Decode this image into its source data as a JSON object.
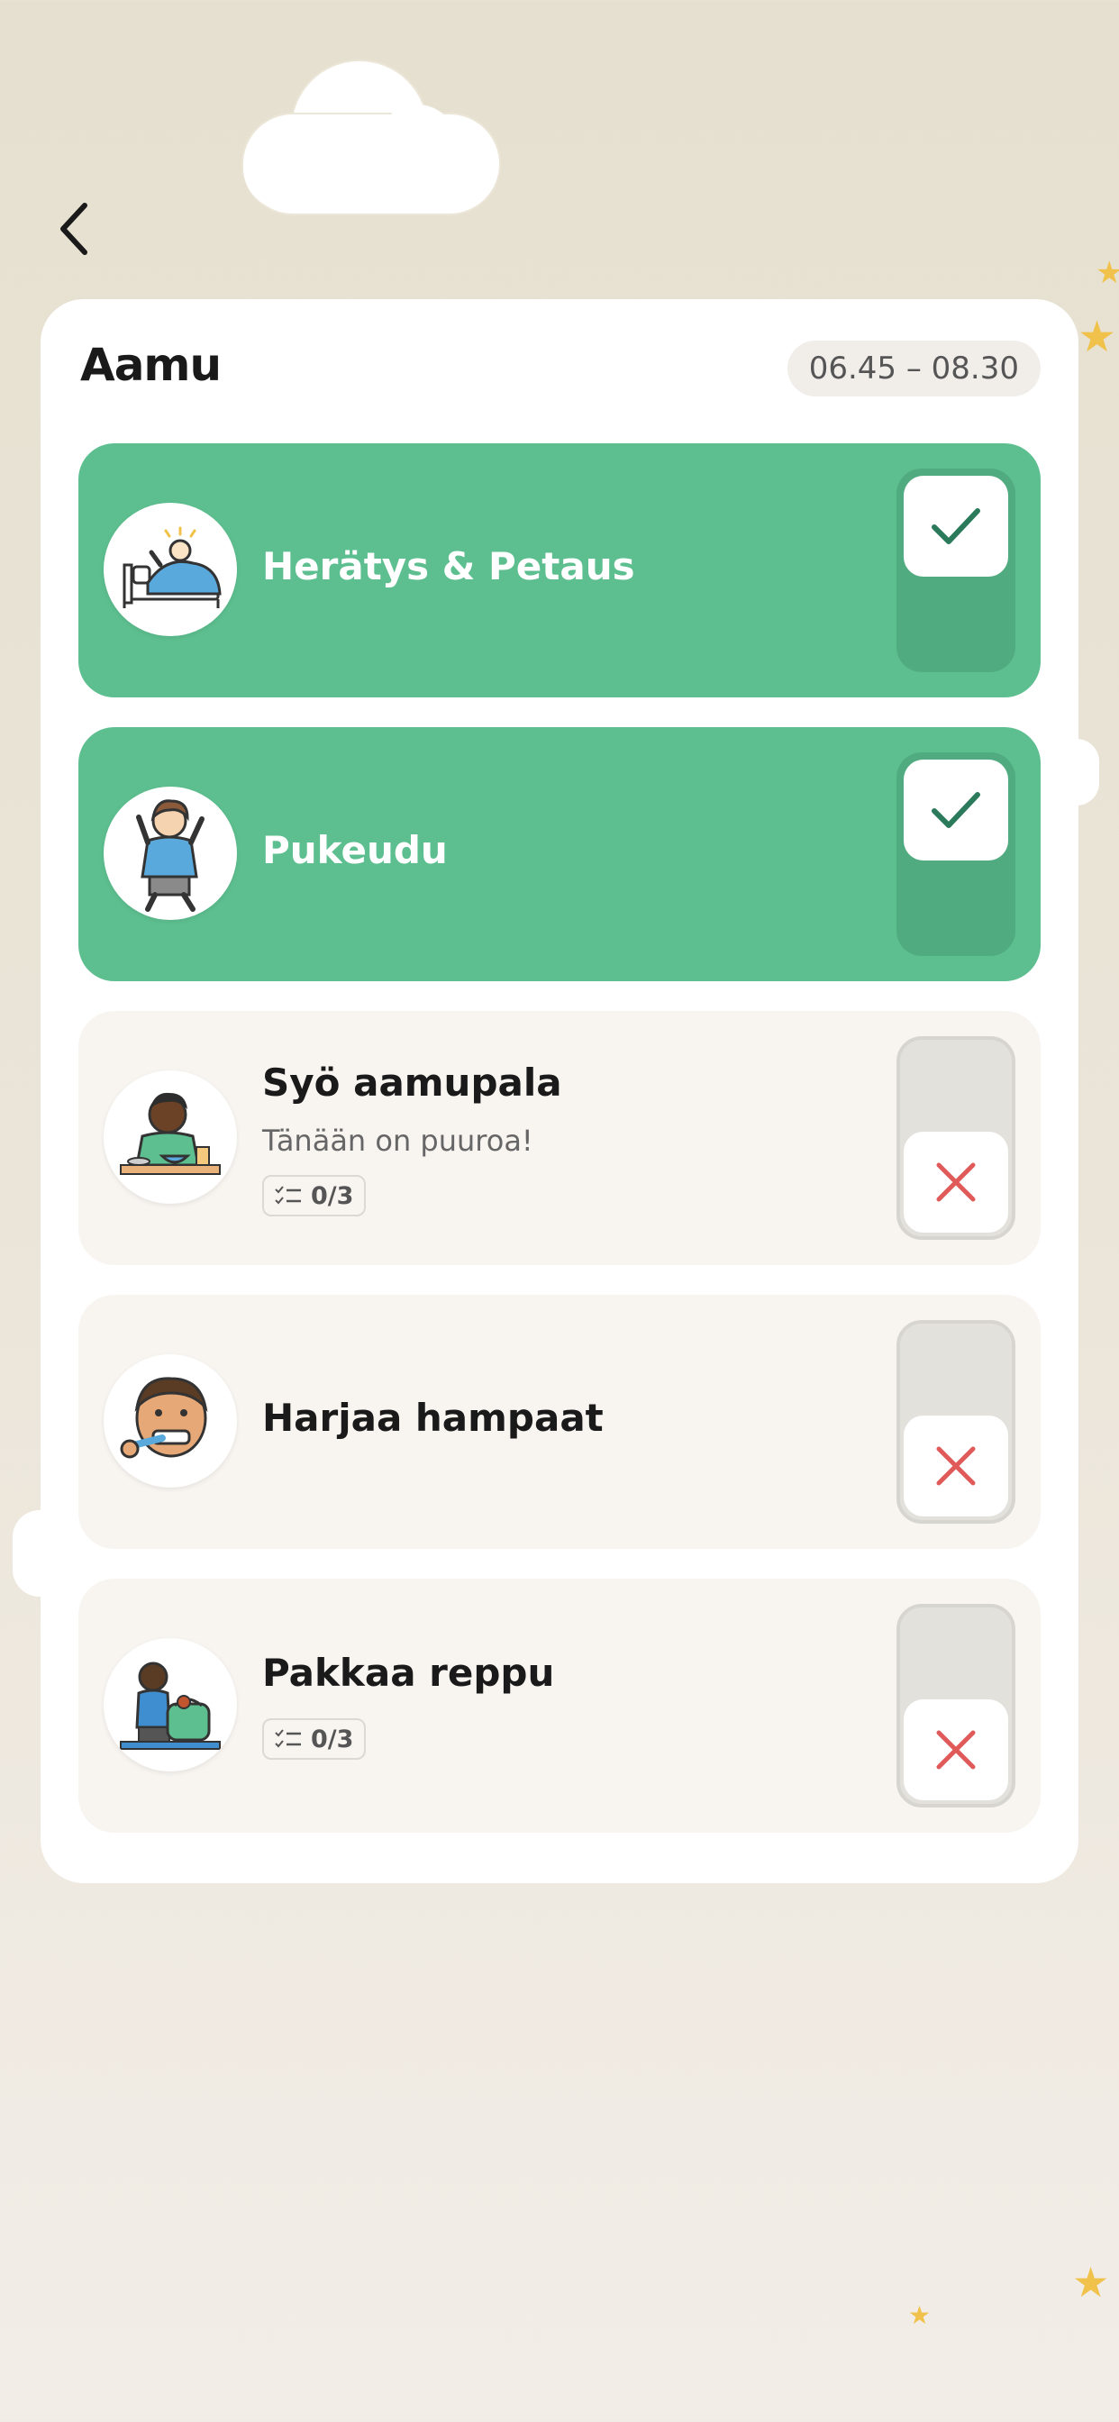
{
  "screen": {
    "title": "Aamu",
    "time_range": "06.45 – 08.30"
  },
  "colors": {
    "done_green": "#5dbf8f",
    "check_green": "#2b7a5c",
    "cross_red": "#e05a5a",
    "star_gold": "#f0c24b"
  },
  "tasks": [
    {
      "title": "Herätys & Petaus",
      "status": "done",
      "icon": "waking-up-illustration"
    },
    {
      "title": "Pukeudu",
      "status": "done",
      "icon": "getting-dressed-illustration"
    },
    {
      "title": "Syö aamupala",
      "subtitle": "Tänään on puuroa!",
      "counter": "0/3",
      "status": "not-done",
      "icon": "eating-breakfast-illustration"
    },
    {
      "title": "Harjaa hampaat",
      "status": "not-done",
      "icon": "brushing-teeth-illustration"
    },
    {
      "title": "Pakkaa reppu",
      "counter": "0/3",
      "status": "not-done",
      "icon": "packing-backpack-illustration"
    }
  ]
}
